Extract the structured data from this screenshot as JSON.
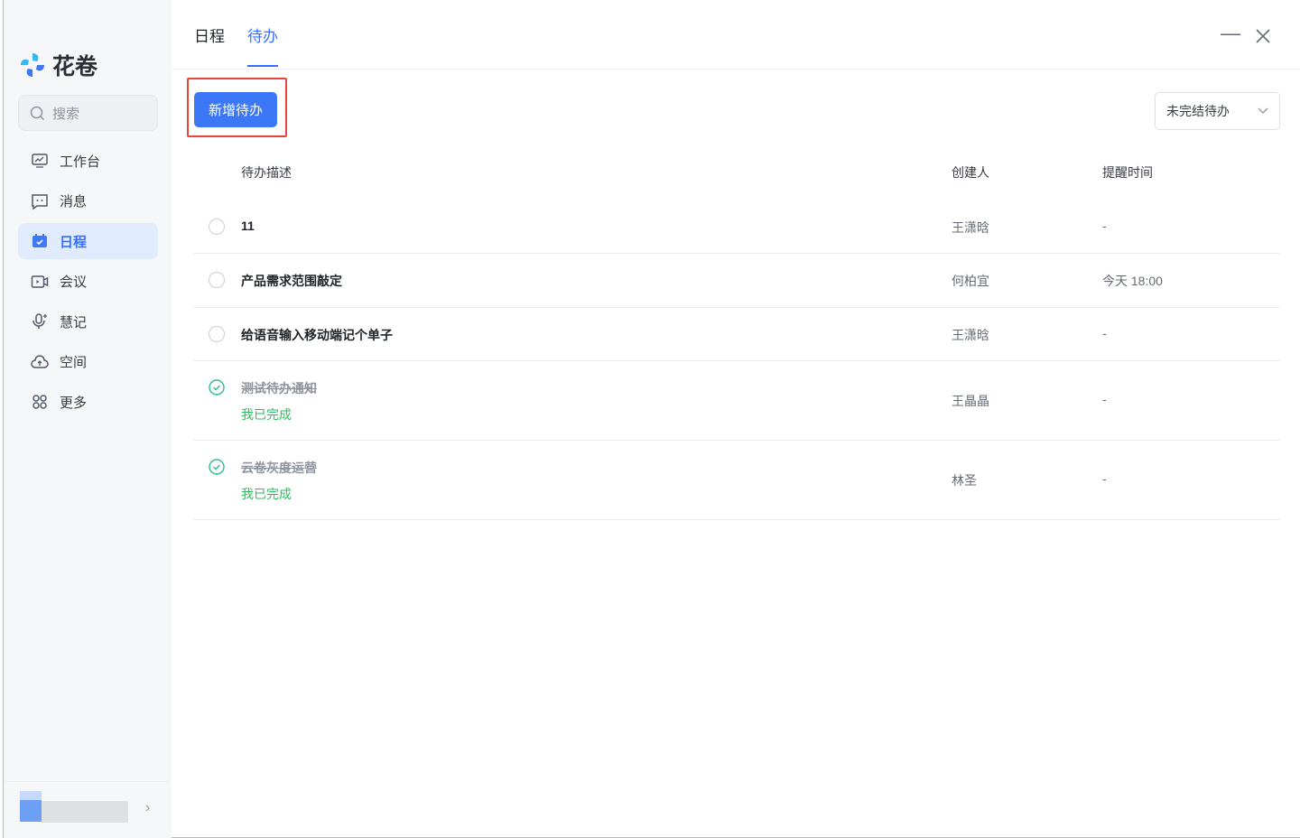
{
  "app": {
    "name": "花卷",
    "search_placeholder": "搜索"
  },
  "sidebar": {
    "items": [
      {
        "label": "工作台",
        "icon": "dashboard-icon"
      },
      {
        "label": "消息",
        "icon": "message-icon"
      },
      {
        "label": "日程",
        "icon": "calendar-icon",
        "active": true
      },
      {
        "label": "会议",
        "icon": "video-icon"
      },
      {
        "label": "慧记",
        "icon": "mic-icon"
      },
      {
        "label": "空间",
        "icon": "cloud-upload-icon"
      },
      {
        "label": "更多",
        "icon": "grid-icon"
      }
    ]
  },
  "tabs": [
    {
      "label": "日程"
    },
    {
      "label": "待办",
      "active": true
    }
  ],
  "toolbar": {
    "add_label": "新增待办",
    "filter_value": "未完结待办"
  },
  "table": {
    "headers": {
      "desc": "待办描述",
      "creator": "创建人",
      "remind": "提醒时间"
    },
    "rows": [
      {
        "desc": "11",
        "creator": "王潇晗",
        "remind": "-",
        "done": false
      },
      {
        "desc": "产品需求范围敲定",
        "creator": "何柏宜",
        "remind": "今天 18:00",
        "done": false
      },
      {
        "desc": "给语音输入移动端记个单子",
        "creator": "王潇晗",
        "remind": "-",
        "done": false
      },
      {
        "desc": "测试待办通知",
        "status": "我已完成",
        "creator": "王晶晶",
        "remind": "-",
        "done": true
      },
      {
        "desc": "云卷灰度运营",
        "status": "我已完成",
        "creator": "林圣",
        "remind": "-",
        "done": true
      }
    ]
  },
  "colors": {
    "accent": "#3370ff",
    "done": "#2ebd5f",
    "highlight": "#e8453c"
  }
}
